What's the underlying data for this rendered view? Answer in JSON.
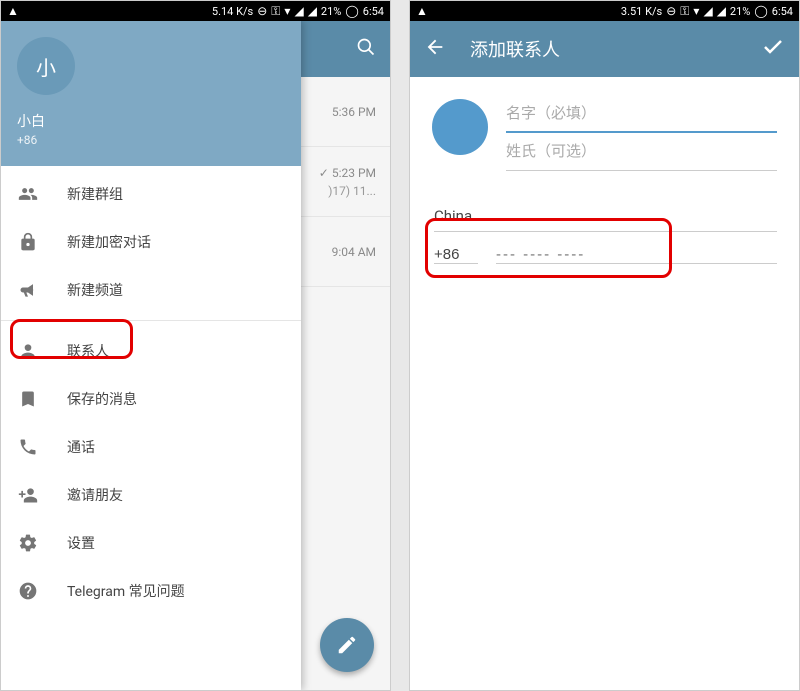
{
  "statusbar": {
    "speed_left": "5.14 K/s",
    "speed_right": "3.51 K/s",
    "battery": "21%",
    "time": "6:54"
  },
  "left": {
    "user": {
      "avatar_text": "小",
      "name": "小白",
      "phone": "+86"
    },
    "drawer": [
      {
        "label": "新建群组"
      },
      {
        "label": "新建加密对话"
      },
      {
        "label": "新建频道"
      },
      {
        "label": "联系人"
      },
      {
        "label": "保存的消息"
      },
      {
        "label": "通话"
      },
      {
        "label": "邀请朋友"
      },
      {
        "label": "设置"
      },
      {
        "label": "Telegram 常见问题"
      }
    ],
    "chat_times": {
      "t1": "5:36 PM",
      "t2": "5:23 PM",
      "t2_sub": ")17) 11...",
      "t3": "9:04 AM"
    }
  },
  "right": {
    "title": "添加联系人",
    "first_name_placeholder": "名字（必填）",
    "last_name_placeholder": "姓氏（可选）",
    "country": "China",
    "prefix": "+86",
    "phone_placeholder": "--- ---- ----"
  }
}
